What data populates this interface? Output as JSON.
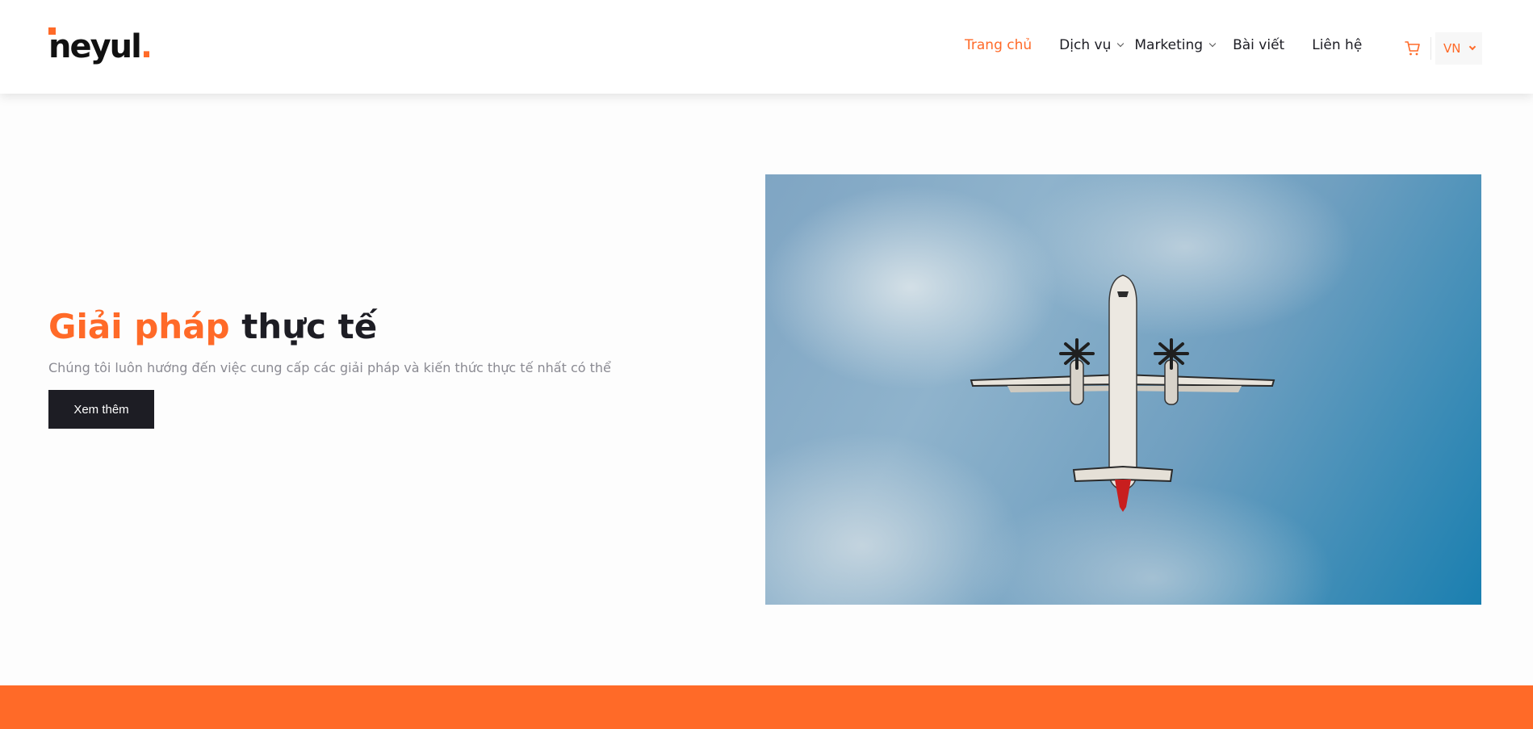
{
  "brand": {
    "logo_text": "neyul",
    "logo_dot": "."
  },
  "nav": {
    "items": [
      {
        "label": "Trang chủ"
      },
      {
        "label": "Dịch vụ"
      },
      {
        "label": "Marketing"
      },
      {
        "label": "Bài viết"
      },
      {
        "label": "Liên hệ"
      }
    ],
    "language": "VN",
    "cart_icon": "cart-icon"
  },
  "hero": {
    "title_accent": "Giải pháp",
    "title_rest": " thực tế",
    "subtitle": "Chúng tôi luôn hướng đến việc cung cấp các giải pháp và kiến thức thực tế nhất có thể",
    "button_label": "Xem thêm",
    "image": "airplane-in-sky-photo"
  },
  "colors": {
    "accent": "#ff6a28",
    "dark": "#1d1d24",
    "muted": "#8a8a92"
  }
}
